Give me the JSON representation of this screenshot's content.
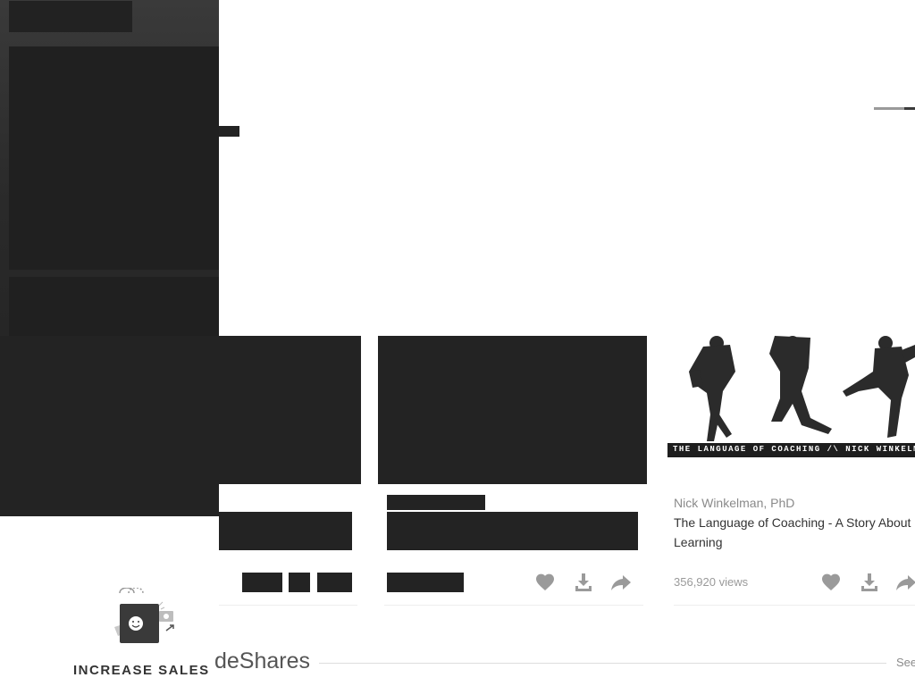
{
  "cards": [
    {
      "author": "",
      "title": "",
      "views": "",
      "redacted": true
    },
    {
      "author": "",
      "title": "",
      "views": "",
      "redacted": true
    },
    {
      "author": "Nick Winkelman, PhD",
      "title": "The Language of Coaching - A Story About Learning",
      "views": "356,920 views",
      "thumbnail_caption": "THE LANGUAGE OF COACHING /\\ NICK WINKELMAN, PH"
    }
  ],
  "actions": {
    "like_icon": "heart-icon",
    "download_icon": "download-icon",
    "share_icon": "share-arrow-icon"
  },
  "promo": {
    "label": "INCREASE SALES",
    "icon": "shopping-bag-icon"
  },
  "section": {
    "title": "deShares",
    "see_all": "See"
  },
  "colors": {
    "redaction": "#232323",
    "icon_gray": "#9a9a9a"
  }
}
